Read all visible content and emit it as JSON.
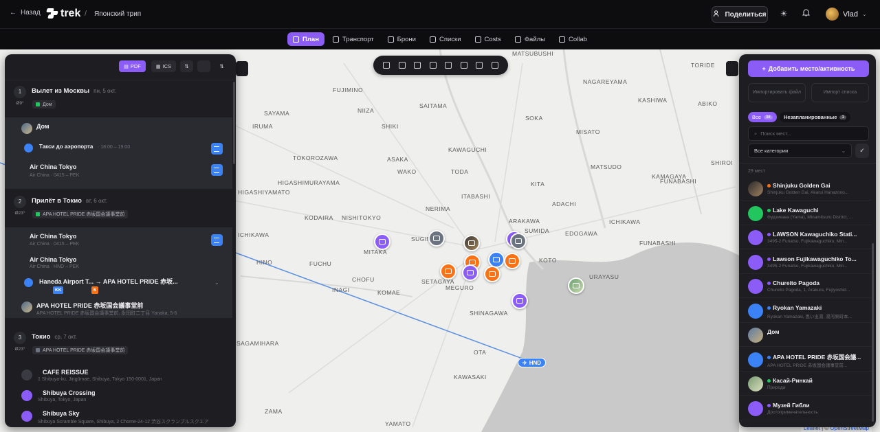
{
  "header": {
    "back_label": "Назад",
    "brand": "trek",
    "separator": "/",
    "trip_title": "Японский трип",
    "share_label": "Поделиться",
    "user_name": "Vlad"
  },
  "tabs": [
    {
      "label": "План",
      "active": true,
      "icon": "map-icon"
    },
    {
      "label": "Транспорт",
      "active": false,
      "icon": "bus-icon"
    },
    {
      "label": "Брони",
      "active": false,
      "icon": "ticket-icon"
    },
    {
      "label": "Списки",
      "active": false,
      "icon": "package-icon"
    },
    {
      "label": "Costs",
      "active": false,
      "icon": "wallet-icon"
    },
    {
      "label": "Файлы",
      "active": false,
      "icon": "folder-icon"
    },
    {
      "label": "Collab",
      "active": false,
      "icon": "users-icon"
    }
  ],
  "map": {
    "labels": [
      "MATSUBUSHI",
      "TORIDE",
      "NAGAREYAMA",
      "FUJIMINO",
      "SAITAMA",
      "KASHIWA",
      "ABIKO",
      "SAYAMA",
      "SHIKI",
      "MISATO",
      "IRUMA",
      "NIIZA",
      "SOKA",
      "NAGAREYAMA",
      "KAWAGUCHI",
      "KAMAGAYA",
      "TOKOROZAWA",
      "ASAKA",
      "WAKO",
      "TODA",
      "MATSUDO",
      "SHIROI",
      "HIGASHIMURAYAMA",
      "KAMAGAYA",
      "HIGASHIYAMATO",
      "ITABASHI",
      "KITA",
      "ADACHI",
      "ICHIKAWA",
      "NERIMA",
      "ARAKAWA",
      "KOTO",
      "FUNABASHI",
      "KODAIRA",
      "NISHITOKYO",
      "SUGINAMI",
      "SUMIDA",
      "EDOGAWA",
      "ICHIKAWA",
      "MITAKA",
      "FUCHU",
      "CHOFU",
      "SETAGAYA",
      "URAYASU",
      "INAGI",
      "KOMAE",
      "MEGURO",
      "SHINAGAWA",
      "SAGAMIHARA",
      "OTA",
      "KAWASAKI",
      "ZAMA",
      "YAMATO",
      "HINO",
      "FUNABASHI"
    ],
    "label_hnd": "HND",
    "attribution_leaflet": "Leaflet",
    "attribution_sep": " | © ",
    "attribution_osm": "OpenStreetMap"
  },
  "left_panel": {
    "pdf_label": "PDF",
    "ics_label": "ICS",
    "days": [
      {
        "num": "1",
        "title": "Вылет из Москвы",
        "date": "пн, 5 окт.",
        "weather": "Ø9°",
        "hotel": "Дом",
        "items": [
          {
            "title": "Дом",
            "sub": ""
          },
          {
            "title": "Такси до аэропорта",
            "sub": "· 18:00 – 19:00"
          },
          {
            "title": "Air China Tokyo",
            "sub": "Air China · 0415 – PEK"
          }
        ]
      },
      {
        "num": "2",
        "title": "Прилёт в Токио",
        "date": "вт, 6 окт.",
        "weather": "Ø23°",
        "hotel": "APA HOTEL PRIDE 赤坂国会議事堂前",
        "items": [
          {
            "title": "Air China Tokyo",
            "sub": "Air China · 0415 – PEK"
          },
          {
            "title": "Air China Tokyo",
            "sub": "Air China · HND – PEK"
          },
          {
            "title": "Haneda Airport T... → APA HOTEL PRIDE 赤坂...",
            "sub": ""
          },
          {
            "title": "APA HOTEL PRIDE 赤坂国会議事堂前",
            "sub": "APA HOTEL PRIDE 赤坂国会議事堂前, 永田町二丁目 Yanaka, 5-6"
          }
        ],
        "chips": [
          "KK",
          "6"
        ]
      },
      {
        "num": "3",
        "title": "Токио",
        "date": "ср, 7 окт.",
        "weather": "Ø23°",
        "hotel": "APA HOTEL PRIDE 赤坂国会議事堂前",
        "items": [
          {
            "title": "CAFE REISSUE",
            "sub": "1 Shibuya-ku, Jingūmae, Shibuya, Tokyo 150-0001, Japan"
          },
          {
            "title": "Shibuya Crossing",
            "sub": "Shibuya, Tokyo, Japan"
          },
          {
            "title": "Shibuya Sky",
            "sub": "Shibuya Scramble Square, Shibuya, 2 Chome-24-12 渋谷スクランブルスクエア"
          }
        ]
      }
    ]
  },
  "right_panel": {
    "add_label": "Добавить место/активность",
    "import_file": "Импортировать файл",
    "import_list": "Импорт списка",
    "filter_all": "Все",
    "filter_all_count": "38",
    "filter_unplanned": "Незапланированные",
    "filter_unplanned_count": "1",
    "search_placeholder": "Поиск мест...",
    "category_select": "Все категории",
    "places_count": "29 мест",
    "places": [
      {
        "name": "Shinjuku Golden Gai",
        "addr": "Shinjuku Golden Gai, Akarui Hanazono...",
        "icon": "photo",
        "cat": "#f97316"
      },
      {
        "name": "Lake Kawaguchi",
        "addr": "Фудзикава (Yama), Minamitsuru District, ...",
        "icon": "green",
        "cat": "#22c55e"
      },
      {
        "name": "LAWSON Kawaguchiko Stati...",
        "addr": "3495-2 Funatsu, Fujikawaguchiko, Min...",
        "icon": "purple",
        "cat": "#8b5cf6"
      },
      {
        "name": "Lawson Fujikawaguchiko To...",
        "addr": "3495-2 Funatsu, Fujikawaguchiko, Min...",
        "icon": "purple",
        "cat": "#8b5cf6"
      },
      {
        "name": "Chureito Pagoda",
        "addr": "Chureito Pagoda, 1, Arakura, Fujiyoshid...",
        "icon": "purple",
        "cat": "#8b5cf6"
      },
      {
        "name": "Ryokan Yamazaki",
        "addr": "Ryokan Yamazaki, 思い出湯, 湯河原町本...",
        "icon": "blue",
        "cat": "#3b82f6"
      },
      {
        "name": "Дом",
        "addr": "",
        "icon": "photo2",
        "cat": ""
      },
      {
        "name": "APA HOTEL PRIDE 赤坂国会議...",
        "addr": "APA HOTEL PRIDE 赤坂国会議事堂前...",
        "icon": "blue",
        "cat": "#3b82f6"
      },
      {
        "name": "Касай-Ринкай",
        "addr": "Природа",
        "icon": "photo3",
        "cat": "#22c55e"
      },
      {
        "name": "Музей Гибли",
        "addr": "Достопримечательность",
        "icon": "purple",
        "cat": "#8b5cf6"
      }
    ]
  },
  "colors": {
    "accent": "#8b5cf6",
    "blue": "#3b82f6",
    "orange": "#f97316",
    "green": "#22c55e"
  }
}
